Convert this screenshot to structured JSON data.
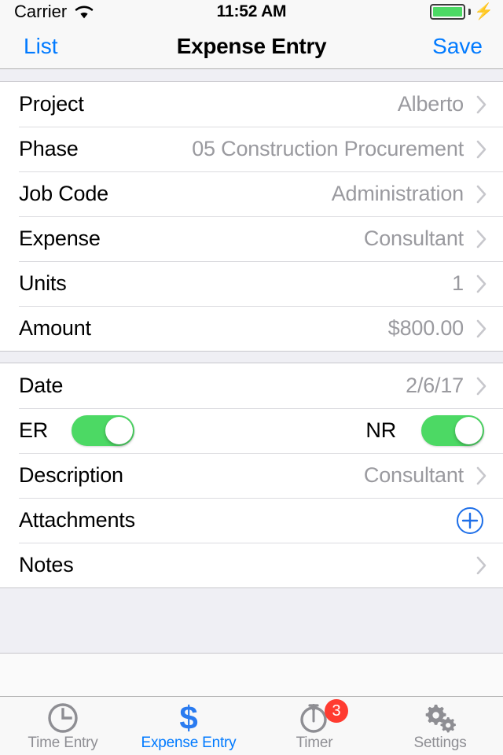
{
  "status_bar": {
    "carrier": "Carrier",
    "time": "11:52 AM",
    "wifi_icon": "wifi-icon",
    "battery_icon": "battery-full-icon",
    "charging_icon": "lightning-bolt-icon"
  },
  "nav_bar": {
    "back_label": "List",
    "title": "Expense Entry",
    "save_label": "Save"
  },
  "colors": {
    "tint_blue": "#007aff",
    "switch_green": "#4cd964",
    "badge_red": "#ff3b30",
    "value_gray": "#9a9a9f",
    "group_background": "#efeff4"
  },
  "form": {
    "section_one": [
      {
        "label": "Project",
        "value": "Alberto",
        "accessory": "chevron-right-icon"
      },
      {
        "label": "Phase",
        "value": "05 Construction Procurement",
        "accessory": "chevron-right-icon"
      },
      {
        "label": "Job Code",
        "value": "Administration",
        "accessory": "chevron-right-icon"
      },
      {
        "label": "Expense",
        "value": "Consultant",
        "accessory": "chevron-right-icon"
      },
      {
        "label": "Units",
        "value": "1",
        "accessory": "chevron-right-icon"
      },
      {
        "label": "Amount",
        "value": "$800.00",
        "accessory": "chevron-right-icon"
      }
    ],
    "date_row": {
      "label": "Date",
      "value": "2/6/17",
      "accessory": "chevron-right-icon"
    },
    "toggle_row": {
      "left_label": "ER",
      "left_state": "on",
      "right_label": "NR",
      "right_state": "on"
    },
    "description_row": {
      "label": "Description",
      "value": "Consultant",
      "accessory": "chevron-right-icon"
    },
    "attachments_row": {
      "label": "Attachments",
      "accessory": "add-circle-icon"
    },
    "notes_row": {
      "label": "Notes",
      "accessory": "chevron-right-icon"
    }
  },
  "tab_bar": {
    "tabs": [
      {
        "label": "Time Entry",
        "icon": "clock-icon",
        "active": false,
        "badge": ""
      },
      {
        "label": "Expense Entry",
        "icon": "dollar-icon",
        "active": true,
        "badge": ""
      },
      {
        "label": "Timer",
        "icon": "stopwatch-icon",
        "active": false,
        "badge": "3"
      },
      {
        "label": "Settings",
        "icon": "gears-icon",
        "active": false,
        "badge": ""
      }
    ]
  }
}
